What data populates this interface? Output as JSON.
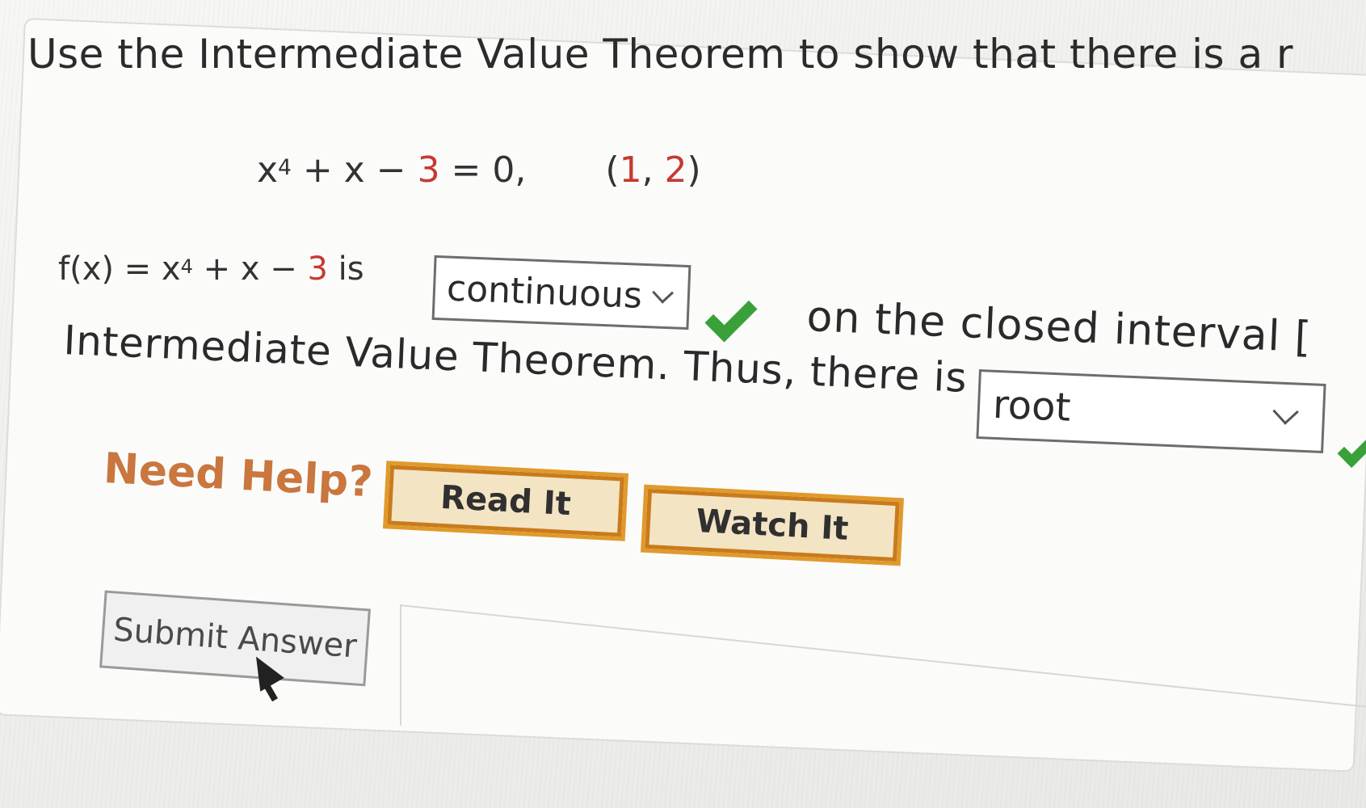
{
  "problem": {
    "statement": "Use the Intermediate Value Theorem to show that there is a r",
    "equation": {
      "base": "x",
      "exponent": "4",
      "middle": " + x − ",
      "constant": "3",
      "tail": " = 0,",
      "interval": "(1, 2)"
    },
    "function_line": {
      "prefix": "f(x) = x",
      "exponent": "4",
      "middle": " + x − ",
      "constant": "3",
      "suffix": " is"
    },
    "continuity_dropdown": "continuous",
    "after_dropdown": "on the closed interval [",
    "ivt_line": "Intermediate Value Theorem. Thus, there is a",
    "root_dropdown": "root"
  },
  "help": {
    "label": "Need Help?",
    "read_button": "Read It",
    "watch_button": "Watch It"
  },
  "submit": {
    "label": "Submit Answer"
  },
  "colors": {
    "accent_red": "#c53a32",
    "check_green": "#3aa03a",
    "help_orange": "#c9763f",
    "button_border": "#e09a2c"
  },
  "icons": [
    "checkmark-icon",
    "chevron-down-icon",
    "mouse-cursor-icon"
  ]
}
